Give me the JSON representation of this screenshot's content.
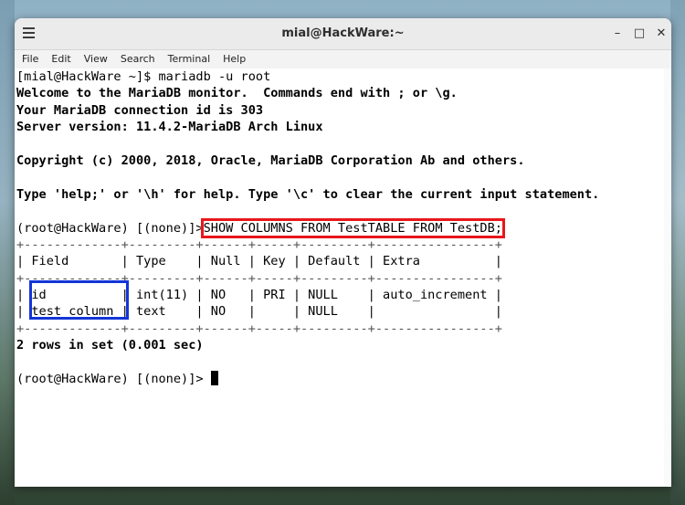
{
  "window": {
    "title": "mial@HackWare:~",
    "min_glyph": "–",
    "max_glyph": "□",
    "close_glyph": "✕"
  },
  "menu": [
    "File",
    "Edit",
    "View",
    "Search",
    "Terminal",
    "Help"
  ],
  "terminal": {
    "prompt1": "[mial@HackWare ~]$ mariadb -u root",
    "welcome": "Welcome to the MariaDB monitor.  Commands end with ; or \\g.",
    "conn_id": "Your MariaDB connection id is 303",
    "server_version": "Server version: 11.4.2-MariaDB Arch Linux",
    "copyright": "Copyright (c) 2000, 2018, Oracle, MariaDB Corporation Ab and others.",
    "help_hint": "Type 'help;' or '\\h' for help. Type '\\c' to clear the current input statement.",
    "prompt2": "(root@HackWare) [(none)]>",
    "command": "SHOW COLUMNS FROM TestTABLE FROM TestDB;",
    "table_border": "+-------------+---------+------+-----+---------+----------------+",
    "table_header": "| Field       | Type    | Null | Key | Default | Extra          |",
    "row1": "| id          | int(11) | NO   | PRI | NULL    | auto_increment |",
    "row2": "| test_column | text    | NO   |     | NULL    |                |",
    "result": "2 rows in set (0.001 sec)",
    "prompt3": "(root@HackWare) [(none)]>"
  },
  "colors": {
    "highlight_command": "#e8171b",
    "highlight_fields": "#1435d8"
  }
}
